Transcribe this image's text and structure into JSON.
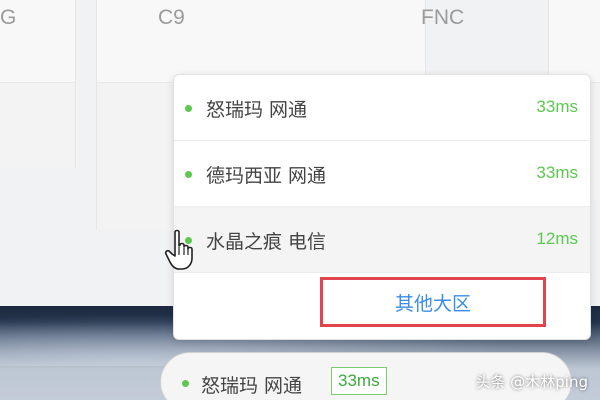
{
  "teams": [
    "G",
    "C9",
    "FNC"
  ],
  "server_list": [
    {
      "name": "怒瑞玛 网通",
      "latency": "33ms"
    },
    {
      "name": "德玛西亚 网通",
      "latency": "33ms"
    },
    {
      "name": "水晶之痕 电信",
      "latency": "12ms"
    }
  ],
  "other_regions_label": "其他大区",
  "selected_server": {
    "name": "怒瑞玛 网通",
    "latency": "33ms"
  },
  "watermark": "头条 @木林ping",
  "colors": {
    "online": "#5cc84f",
    "link": "#3a8ee6",
    "highlight_border": "#e1444c"
  },
  "icons": {
    "status": "status-dot-icon",
    "cursor": "hand-cursor-icon"
  }
}
